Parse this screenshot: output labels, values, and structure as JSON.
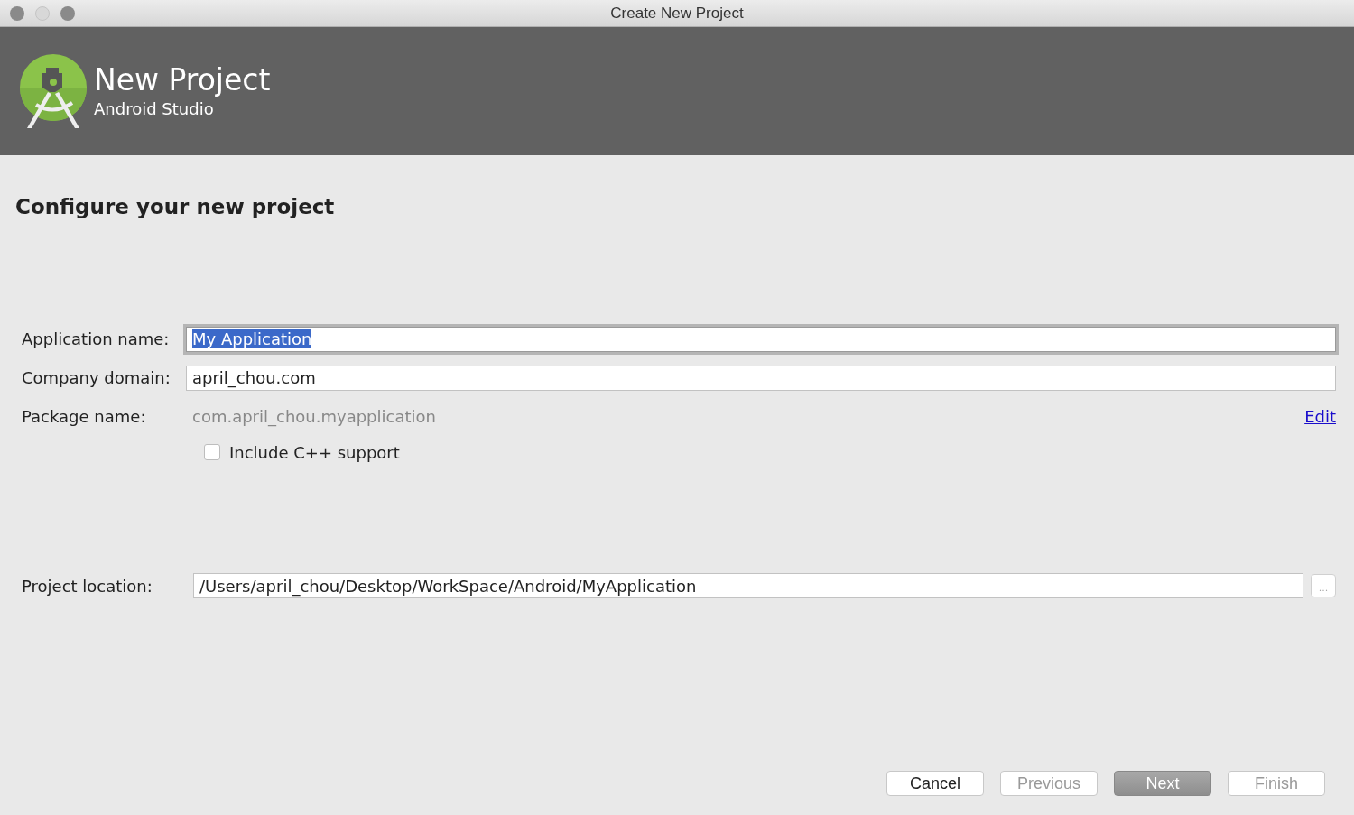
{
  "window": {
    "title": "Create New Project"
  },
  "header": {
    "title": "New Project",
    "subtitle": "Android Studio"
  },
  "page_title": "Configure your new project",
  "fields": [
    {
      "kind": "input",
      "label": "Application name:",
      "value": "My Application",
      "focused": true,
      "text_selected": true
    },
    {
      "kind": "input",
      "label": "Company domain:",
      "value": "april_chou.com",
      "focused": false,
      "text_selected": false
    },
    {
      "kind": "readonly",
      "label": "Package name:",
      "value": "com.april_chou.myapplication",
      "link": "Edit"
    }
  ],
  "cpp_checkbox": {
    "label": "Include C++ support",
    "checked": false
  },
  "location": {
    "label": "Project location:",
    "value": "/Users/april_chou/Desktop/WorkSpace/Android/MyApplication",
    "browse": "..."
  },
  "buttons": [
    {
      "label": "Cancel",
      "kind": "normal",
      "disabled": false
    },
    {
      "label": "Previous",
      "kind": "normal",
      "disabled": true
    },
    {
      "label": "Next",
      "kind": "default",
      "disabled": true
    },
    {
      "label": "Finish",
      "kind": "normal",
      "disabled": true
    }
  ]
}
